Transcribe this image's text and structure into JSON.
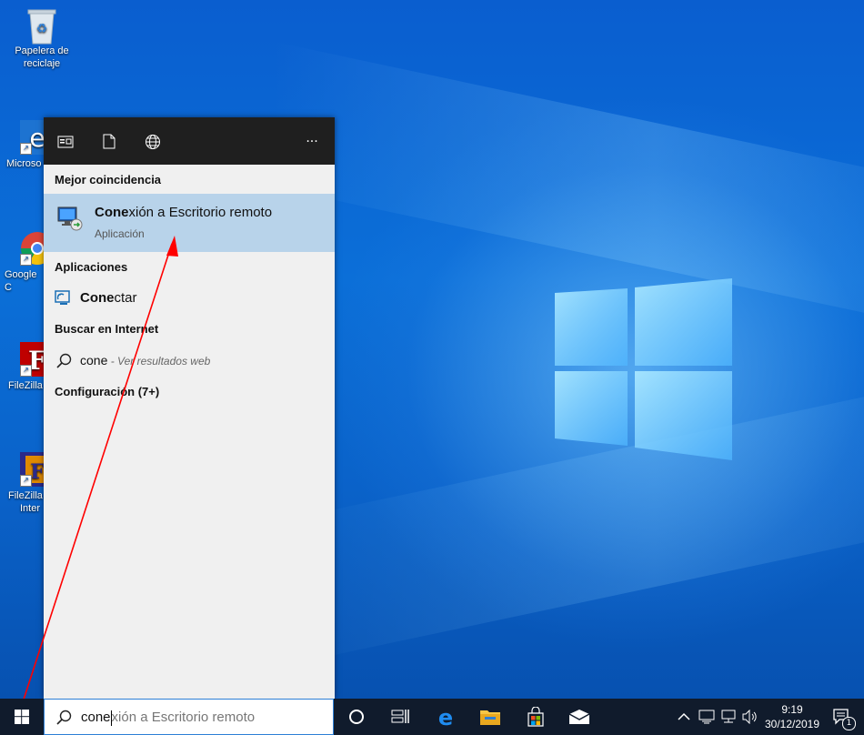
{
  "desktop": {
    "icons": [
      {
        "label": "Papelera de reciclaje"
      },
      {
        "label": "Microso"
      },
      {
        "label": "Google C"
      },
      {
        "label": "FileZilla"
      },
      {
        "label_line1": "FileZilla",
        "label_line2": "Inter"
      }
    ]
  },
  "start_panel": {
    "toolbar": {
      "apps_icon": "apps-filter-icon",
      "docs_icon": "documents-filter-icon",
      "web_icon": "web-filter-icon",
      "more_label": "···"
    },
    "best_match_heading": "Mejor coincidencia",
    "best_match": {
      "title_bold": "Cone",
      "title_rest": "xión a Escritorio remoto",
      "subtitle": "Aplicación",
      "icon": "remote-desktop-icon"
    },
    "apps_heading": "Aplicaciones",
    "apps": [
      {
        "label_bold": "Cone",
        "label_rest": "ctar",
        "icon": "connect-app-icon"
      }
    ],
    "web_heading": "Buscar en Internet",
    "web_result": {
      "query": "cone",
      "suffix": " - Ver resultados web",
      "icon": "search-icon"
    },
    "settings_heading": "Configuración (7+)"
  },
  "taskbar": {
    "search": {
      "typed": "cone",
      "ghost": "xión a Escritorio remoto"
    },
    "clock": {
      "time": "9:19",
      "date": "30/12/2019"
    },
    "notification_count": "1"
  },
  "colors": {
    "accent": "#2d7fd6",
    "highlight": "#b8d3ea",
    "taskbar": "#101b2c",
    "panel": "#f0f0f0",
    "arrow": "#ff0000"
  }
}
